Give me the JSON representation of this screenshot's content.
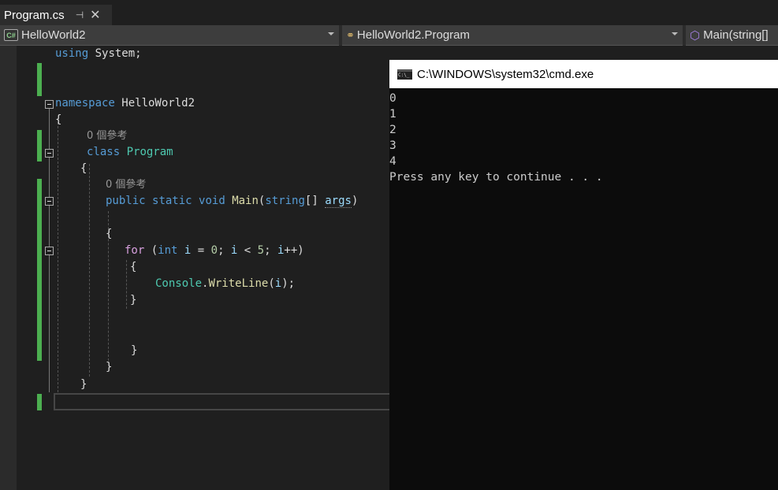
{
  "tab": {
    "title": "Program.cs",
    "pin_icon": "pin-icon",
    "close_icon": "close-icon"
  },
  "navbar": {
    "project": "HelloWorld2",
    "class": "HelloWorld2.Program",
    "member": "Main(string[]"
  },
  "code": {
    "using": [
      "using",
      " System;"
    ],
    "namespace": [
      "namespace",
      " HelloWorld2"
    ],
    "open1": "{",
    "lens1": "0 個參考",
    "class": [
      "class",
      " ",
      "Program"
    ],
    "open2": "{",
    "lens2": "0 個參考",
    "main": [
      "public",
      " ",
      "static",
      " ",
      "void",
      " ",
      "Main",
      "(",
      "string",
      "[] ",
      "args",
      ")"
    ],
    "open3": "{",
    "for": [
      "for",
      " (",
      "int",
      " ",
      "i",
      " = ",
      "0",
      "; ",
      "i",
      " < ",
      "5",
      "; ",
      "i",
      "++)"
    ],
    "open4": "{",
    "console": [
      "Console",
      ".",
      "WriteLine",
      "(",
      "i",
      ");"
    ],
    "close4": "}",
    "close3": "}",
    "close2": "}",
    "close1": "}"
  },
  "console": {
    "title": "C:\\WINDOWS\\system32\\cmd.exe",
    "lines": [
      "0",
      "1",
      "2",
      "3",
      "4",
      "Press any key to continue . . ."
    ]
  },
  "colors": {
    "keyword": "#569cd6",
    "type": "#4ec9b0",
    "method": "#dcdcaa",
    "control": "#d8a0df",
    "variable": "#9cdcfe",
    "number": "#b5cea8",
    "change_bar": "#4caf50"
  }
}
